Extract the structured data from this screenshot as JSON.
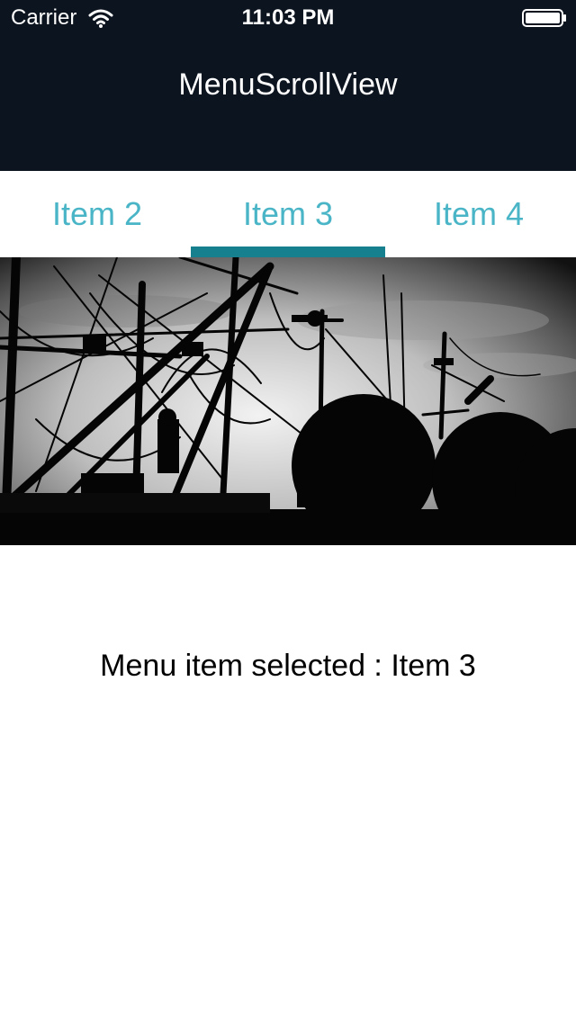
{
  "status_bar": {
    "carrier": "Carrier",
    "time": "11:03 PM",
    "wifi_icon": "wifi-icon",
    "battery_icon": "battery-icon"
  },
  "nav": {
    "title": "MenuScrollView"
  },
  "menu": {
    "items": [
      {
        "label": "Item 2"
      },
      {
        "label": "Item 3",
        "selected": true
      },
      {
        "label": "Item 4"
      }
    ],
    "text_color": "#4ab5c6",
    "indicator_color": "#17808f"
  },
  "content": {
    "selected_message": "Menu item selected : Item 3"
  },
  "colors": {
    "nav_background": "#0c141f",
    "background": "#ffffff"
  }
}
